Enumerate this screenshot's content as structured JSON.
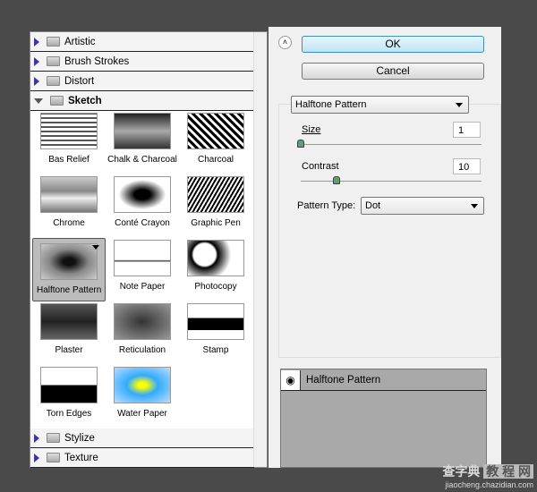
{
  "categories_top": [
    {
      "label": "Artistic",
      "open": false
    },
    {
      "label": "Brush Strokes",
      "open": false
    },
    {
      "label": "Distort",
      "open": false
    },
    {
      "label": "Sketch",
      "open": true
    }
  ],
  "filters": [
    {
      "label": "Bas Relief"
    },
    {
      "label": "Chalk & Charcoal"
    },
    {
      "label": "Charcoal"
    },
    {
      "label": "Chrome"
    },
    {
      "label": "Conté Crayon"
    },
    {
      "label": "Graphic Pen"
    },
    {
      "label": "Halftone Pattern",
      "selected": true
    },
    {
      "label": "Note Paper"
    },
    {
      "label": "Photocopy"
    },
    {
      "label": "Plaster"
    },
    {
      "label": "Reticulation"
    },
    {
      "label": "Stamp"
    },
    {
      "label": "Torn Edges"
    },
    {
      "label": "Water Paper"
    }
  ],
  "categories_bottom": [
    {
      "label": "Stylize"
    },
    {
      "label": "Texture"
    }
  ],
  "buttons": {
    "ok": "OK",
    "cancel": "Cancel"
  },
  "filter_select": "Halftone Pattern",
  "params": {
    "size": {
      "label": "Size",
      "value": "1",
      "slider_fraction": 0.0
    },
    "contrast": {
      "label": "Contrast",
      "value": "10",
      "slider_fraction": 0.2
    },
    "pattern_type": {
      "label": "Pattern Type:",
      "value": "Dot"
    }
  },
  "layers": [
    {
      "label": "Halftone Pattern",
      "visible": true
    }
  ],
  "watermark": {
    "text1": "查字典",
    "text2": "教 程 网",
    "url": "jiaocheng.chazidian.com"
  }
}
